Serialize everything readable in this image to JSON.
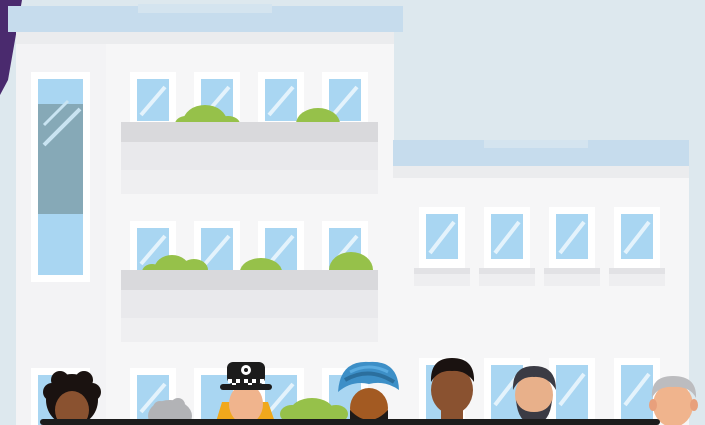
{
  "colors": {
    "sky": "#dde8ee",
    "purple_accent": "#4a2a6e",
    "building_wall": "#f6f6f7",
    "building_shadow": "#ebecee",
    "roof_trim": "#c6dced",
    "window_frame": "#ffffff",
    "window_glass": "#a9d6f2",
    "window_shine": "#e4f3fc",
    "tall_window_blind": "#86a9b7",
    "planter": "#d9d9dc",
    "planter_shadow": "#e7e7ea",
    "foliage": "#96c14a",
    "ground_strip": "#1c1c1c"
  },
  "scene": {
    "description_icons": [
      "large-building-icon",
      "small-building-icon",
      "planter-icon",
      "person-curly-hair-icon",
      "person-grey-hair-icon",
      "police-officer-icon",
      "person-turban-icon",
      "person-short-hair-icon",
      "person-beard-icon",
      "person-elderly-icon"
    ]
  }
}
